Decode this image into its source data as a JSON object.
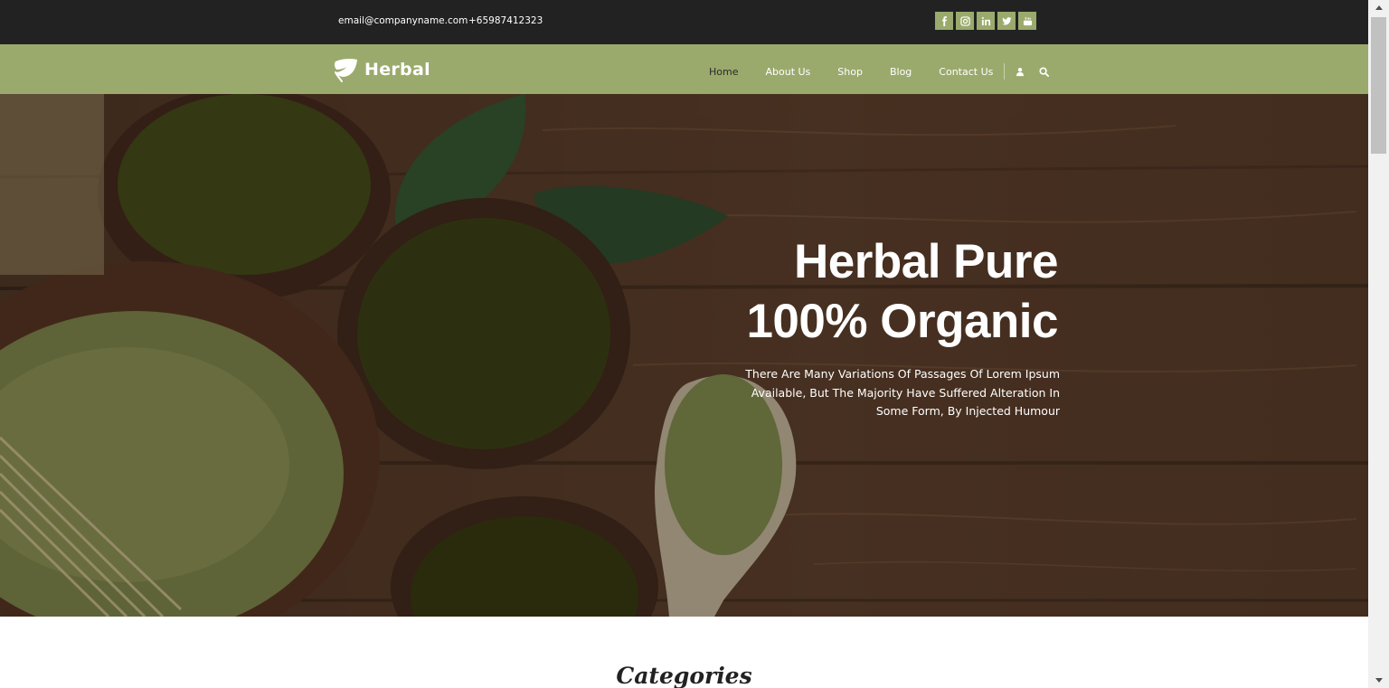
{
  "topbar": {
    "email": "email@companyname.com",
    "phone": "+65987412323",
    "social": [
      "facebook-icon",
      "instagram-icon",
      "linkedin-icon",
      "twitter-icon",
      "youtube-icon"
    ]
  },
  "navbar": {
    "brand": "Herbal",
    "menu": [
      {
        "label": "Home",
        "active": true
      },
      {
        "label": "About Us",
        "active": false
      },
      {
        "label": "Shop",
        "active": false
      },
      {
        "label": "Blog",
        "active": false
      },
      {
        "label": "Contact Us",
        "active": false
      }
    ],
    "icons": [
      "user-icon",
      "search-icon"
    ]
  },
  "hero": {
    "title_line1": "Herbal Pure",
    "title_line2": "100% Organic",
    "subtitle_line1": "There Are Many Variations Of Passages Of Lorem Ipsum",
    "subtitle_line2": "Available, But The Majority Have Suffered Alteration In",
    "subtitle_line3": "Some Form, By Injected Humour"
  },
  "sections": {
    "categories_title": "Categories"
  },
  "colors": {
    "topbar": "#222222",
    "navbar": "#9aaa6c",
    "social_button": "#9aaa6c",
    "active_menu": "#2a2a2a"
  }
}
